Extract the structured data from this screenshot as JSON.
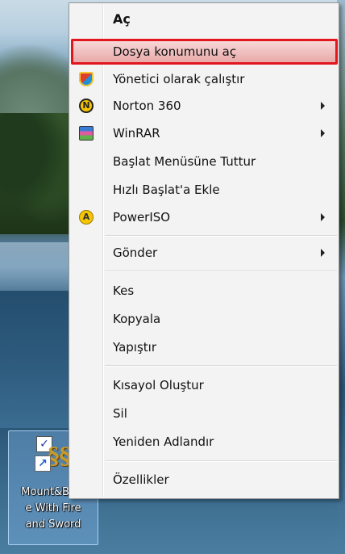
{
  "desktop": {
    "shortcut": {
      "label_lines": [
        "Mount&Blad",
        "e With Fire",
        "and Sword"
      ]
    }
  },
  "context_menu": {
    "items": [
      {
        "label": "Aç",
        "bold": true
      },
      {
        "label": "Dosya konumunu aç",
        "highlighted": true,
        "highlight_color": "#e2161e"
      },
      {
        "label": "Yönetici olarak çalıştır",
        "icon": "uac-shield-icon"
      },
      {
        "label": "Norton 360",
        "icon": "norton-icon",
        "submenu": true
      },
      {
        "label": "WinRAR",
        "icon": "winrar-icon",
        "submenu": true
      },
      {
        "label": "Başlat Menüsüne Tuttur"
      },
      {
        "label": "Hızlı Başlat'a Ekle"
      },
      {
        "label": "PowerISO",
        "icon": "poweriso-icon",
        "submenu": true
      },
      {
        "label": "Gönder",
        "submenu": true
      },
      {
        "label": "Kes"
      },
      {
        "label": "Kopyala"
      },
      {
        "label": "Yapıştır"
      },
      {
        "label": "Kısayol Oluştur"
      },
      {
        "label": "Sil"
      },
      {
        "label": "Yeniden Adlandır"
      },
      {
        "label": "Özellikler"
      }
    ]
  }
}
